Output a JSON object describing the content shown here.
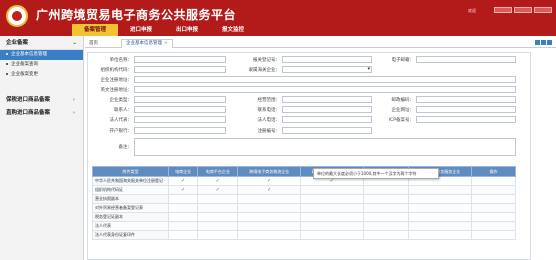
{
  "app": {
    "title": "广州跨境贸易电子商务公共服务平台",
    "user": "欢迎"
  },
  "topnav": [
    "备案管理",
    "进口申报",
    "出口申报",
    "报文监控"
  ],
  "sidebar": {
    "header": "企业备案",
    "items": [
      "企业基本信息管理",
      "企业备案查询",
      "企业备案变更"
    ],
    "groups": [
      "保税进口商品备案",
      "直购进口商品备案"
    ]
  },
  "tabs": {
    "home": "首页",
    "open": "企业基本信息管理",
    "close": "×"
  },
  "form": {
    "labels": {
      "name": "单位名称：",
      "customs_reg": "报关登记号：",
      "email": "电子邮箱：",
      "org_code": "组织机构代码：",
      "customs_area": "隶属海关企业：",
      "reg_address": "企业注册地址：",
      "eng_name": "英文注册地址：",
      "ent_type": "企业类型：",
      "scope": "经营范围：",
      "postcode": "邮政编码：",
      "contact": "联系人：",
      "phone": "联系电话：",
      "web": "企业网址：",
      "legal": "法人代表：",
      "legal_phone": "法人电话：",
      "icp": "ICP备案号：",
      "bank": "开户银行：",
      "reg_no": "注册编号：",
      "remark": "备注："
    },
    "values": {
      "name": "",
      "customs_area": "",
      "postcode": ""
    }
  },
  "table": {
    "headers": [
      "附件类型",
      "电商企业",
      "电商平台企业",
      "跨境电子商务物流企业",
      "跨境电子商务支付企业",
      "进出口商品企业",
      "跨境电子商务服务企业",
      "操作"
    ],
    "rows": [
      {
        "label": "中华人民共和国海关报关单位注册登记",
        "ticks": [
          true,
          true,
          true,
          true,
          false,
          false
        ]
      },
      {
        "label": "组织机构代码证",
        "ticks": [
          true,
          true,
          true,
          false,
          false,
          false
        ]
      },
      {
        "label": "营业执照副本",
        "ticks": [
          false,
          false,
          false,
          false,
          false,
          false
        ]
      },
      {
        "label": "对外贸易经营者备案登记表",
        "ticks": [
          false,
          false,
          false,
          false,
          false,
          false
        ]
      },
      {
        "label": "税务登记证副本",
        "ticks": [
          false,
          false,
          false,
          false,
          false,
          false
        ]
      },
      {
        "label": "法人代表",
        "ticks": [
          false,
          false,
          false,
          false,
          false,
          false
        ]
      },
      {
        "label": "法人代表身份证复印件",
        "ticks": [
          false,
          false,
          false,
          false,
          false,
          false
        ]
      }
    ],
    "tick_glyph": "✓"
  },
  "tooltip": "单位的最大长度必须小于1000,其中一个汉字为两个字符"
}
